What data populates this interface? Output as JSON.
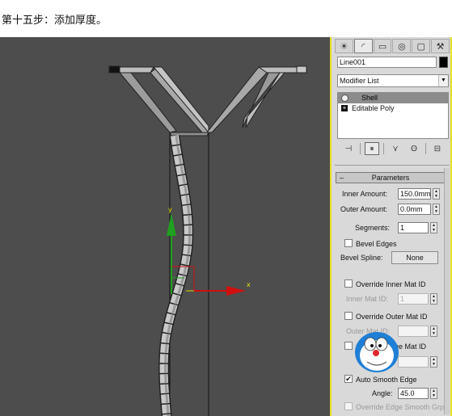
{
  "caption": "第十五步：添加厚度。",
  "command_panel": {
    "tabs": [
      "create-icon",
      "modify-icon",
      "hierarchy-icon",
      "motion-icon",
      "display-icon",
      "utilities-icon"
    ],
    "object_name": "Line001",
    "object_color": "#000000",
    "modifier_list": "Modifier List",
    "stack": [
      {
        "label": "Shell",
        "selected": true
      },
      {
        "label": "Editable Poly",
        "selected": false
      }
    ]
  },
  "parameters": {
    "title": "Parameters",
    "inner_amount_label": "Inner Amount:",
    "inner_amount_value": "150.0mm",
    "outer_amount_label": "Outer Amount:",
    "outer_amount_value": "0.0mm",
    "segments_label": "Segments:",
    "segments_value": "1",
    "bevel_edges_label": "Bevel Edges",
    "bevel_spline_label": "Bevel Spline:",
    "bevel_spline_button": "None",
    "override_inner_label": "Override Inner Mat ID",
    "inner_mat_id_label": "Inner Mat ID:",
    "inner_mat_id_value": "1",
    "override_outer_label": "Override Outer Mat ID",
    "outer_mat_id_label": "Outer Mat ID:",
    "override_edge_label": "Override Edge Mat ID",
    "auto_smooth_label": "Auto Smooth Edge",
    "auto_smooth_checked": true,
    "angle_label": "Angle:",
    "angle_value": "45.0",
    "override_smooth_label": "Override Edge Smooth Grp"
  },
  "colors": {
    "viewport_bg": "#4d4d4d",
    "panel_bg": "#d9d9d9",
    "panel_border": "#e8e020",
    "gizmo_y": "#1fa01f",
    "gizmo_x": "#d01010",
    "gizmo_z": "#e6e600"
  }
}
